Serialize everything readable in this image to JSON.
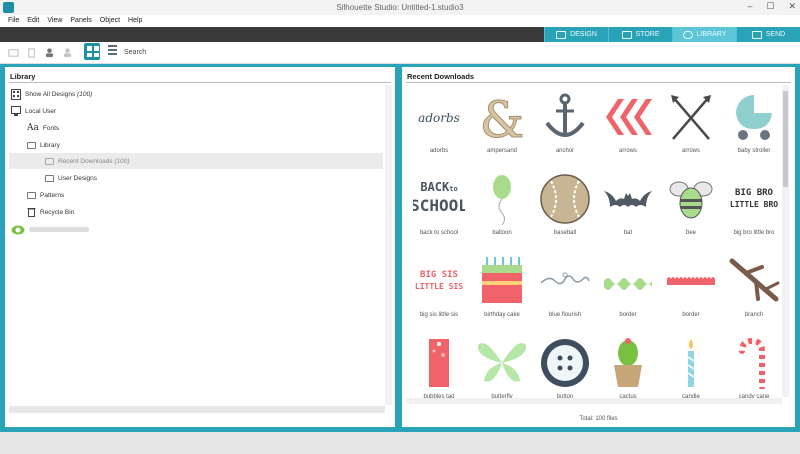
{
  "window": {
    "title": "Silhouette Studio: Untitled-1.studio3",
    "min": "–",
    "max": "☐",
    "close": "✕"
  },
  "menu": [
    "File",
    "Edit",
    "View",
    "Panels",
    "Object",
    "Help"
  ],
  "tabs": [
    {
      "label": "DESIGN",
      "icon": "design-icon",
      "active": false
    },
    {
      "label": "STORE",
      "icon": "store-icon",
      "active": false
    },
    {
      "label": "LIBRARY",
      "icon": "cloud-icon",
      "active": true
    },
    {
      "label": "SEND",
      "icon": "cutter-icon",
      "active": false
    }
  ],
  "toolbar": {
    "search_label": "Search"
  },
  "library": {
    "title": "Library",
    "show_all": "Show All Designs",
    "show_all_count": "(100)",
    "local_user": "Local User",
    "fonts": "Fonts",
    "library_folder": "Library",
    "recent_downloads": "Recent Downloads",
    "recent_count": "(100)",
    "user_designs": "User Designs",
    "patterns": "Patterns",
    "recycle_bin": "Recycle Bin"
  },
  "recent": {
    "title": "Recent Downloads",
    "total": "Total: 100 files",
    "items": [
      {
        "label": "adorbs",
        "icon": "adorbs-word-icon",
        "text": "adorbs"
      },
      {
        "label": "ampersand",
        "icon": "ampersand-icon",
        "text": "&"
      },
      {
        "label": "anchor",
        "icon": "anchor-icon"
      },
      {
        "label": "arrows",
        "icon": "arrows-chevron-icon"
      },
      {
        "label": "arrows",
        "icon": "crossed-arrows-icon"
      },
      {
        "label": "baby stroller",
        "icon": "baby-stroller-icon"
      },
      {
        "label": "back to school",
        "icon": "back-to-school-word-icon",
        "text": "BACK to SCHOOL"
      },
      {
        "label": "balloon",
        "icon": "balloon-icon"
      },
      {
        "label": "baseball",
        "icon": "baseball-icon"
      },
      {
        "label": "bat",
        "icon": "bat-icon"
      },
      {
        "label": "bee",
        "icon": "bee-icon"
      },
      {
        "label": "big bro little bro",
        "icon": "big-bro-word-icon",
        "text": "BIG BRO LITTLE BRO"
      },
      {
        "label": "big sis little sis",
        "icon": "big-sis-word-icon",
        "text": "BIG SIS LITTLE SIS"
      },
      {
        "label": "birthday cake",
        "icon": "birthday-cake-icon"
      },
      {
        "label": "blue flourish",
        "icon": "blue-flourish-icon"
      },
      {
        "label": "border",
        "icon": "border-wave-icon"
      },
      {
        "label": "border",
        "icon": "border-scallop-icon"
      },
      {
        "label": "branch",
        "icon": "branch-icon"
      },
      {
        "label": "bubbles tag",
        "icon": "bubbles-tag-icon"
      },
      {
        "label": "butterfly",
        "icon": "butterfly-icon"
      },
      {
        "label": "button",
        "icon": "button-icon"
      },
      {
        "label": "cactus",
        "icon": "cactus-icon"
      },
      {
        "label": "candle",
        "icon": "candle-icon"
      },
      {
        "label": "candy cane",
        "icon": "candy-cane-icon"
      }
    ]
  },
  "colors": {
    "accent": "#2aa3b8",
    "active_tab": "#5cc6d8",
    "dark_bar": "#3a3a3a"
  }
}
